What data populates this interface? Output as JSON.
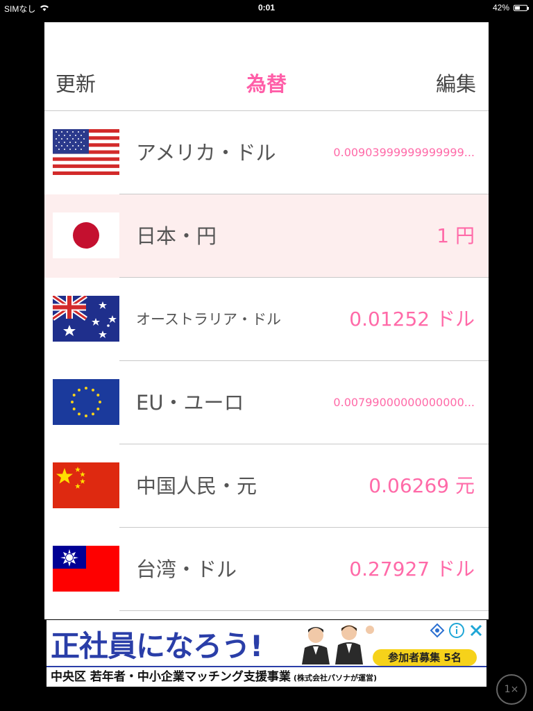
{
  "status_bar": {
    "carrier": "SIMなし",
    "time": "0:01",
    "battery": "42%",
    "battery_level": 0.42
  },
  "nav": {
    "left": "更新",
    "title": "為替",
    "right": "編集"
  },
  "currencies": [
    {
      "name": "アメリカ・ドル",
      "rate": "0.00903999999999999...",
      "flag": "us-flag"
    },
    {
      "name": "日本・円",
      "rate": "1 円",
      "flag": "japan-flag",
      "selected": true
    },
    {
      "name": "オーストラリア・ドル",
      "rate": "0.01252 ドル",
      "flag": "australia-flag"
    },
    {
      "name": "EU・ユーロ",
      "rate": "0.00799000000000000...",
      "flag": "eu-flag"
    },
    {
      "name": "中国人民・元",
      "rate": "0.06269 元",
      "flag": "china-flag"
    },
    {
      "name": "台湾・ドル",
      "rate": "0.27927 ドル",
      "flag": "taiwan-flag"
    }
  ],
  "ad": {
    "headline": "正社員になろう!",
    "badge": "参加者募集 5名",
    "bottom": "中央区 若年者・中小企業マッチング支援事業",
    "bottom_small": "(株式会社パソナが運営)"
  },
  "zoom": "1×",
  "colors": {
    "accent": "#ff5ea8",
    "rate_text": "#ff6aa8",
    "selected_row": "#fdeeee",
    "ad_blue": "#2a3ea8",
    "ad_yellow": "#f6d21a"
  }
}
